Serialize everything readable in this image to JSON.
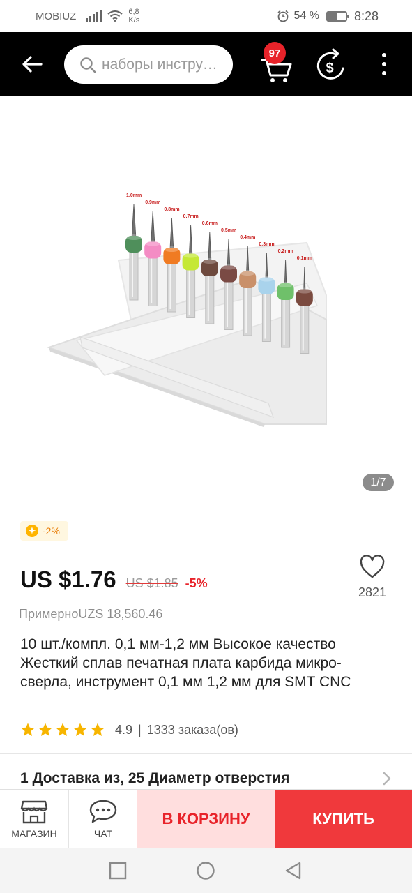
{
  "status_bar": {
    "carrier": "MOBIUZ",
    "speed_value": "6,8",
    "speed_unit": "K/s",
    "battery": "54 %",
    "battery_level": 0.54,
    "time": "8:28"
  },
  "app_bar": {
    "search_placeholder": "наборы инструменты",
    "cart_count": "97",
    "icons": [
      "back-arrow-icon",
      "search-icon",
      "cart-icon",
      "coin-cashback-icon",
      "more-vertical-icon"
    ]
  },
  "gallery": {
    "counter": "1/7",
    "drill_labels": [
      "1.0mm",
      "0.9mm",
      "0.8mm",
      "0.7mm",
      "0.6mm",
      "0.5mm",
      "0.4mm",
      "0.3mm",
      "0.2mm",
      "0.1mm"
    ],
    "ring_colors": [
      "#4f8f5b",
      "#f48cc4",
      "#f07b22",
      "#c5e836",
      "#6e4a3e",
      "#7a4a44",
      "#c9906a",
      "#a9d3ec",
      "#6fc06a",
      "#7a4a3f"
    ]
  },
  "product": {
    "coupon": "-2%",
    "price": "US $1.76",
    "old_price": "US $1.85",
    "discount": "-5%",
    "wishlist_count": "2821",
    "approx_price": "ПримерноUZS 18,560.46",
    "title": "10 шт./компл. 0,1 мм-1,2 мм Высокое качество Жесткий сплав печатная плата карбида микро-сверла, инструмент 0,1 мм 1,2 мм для SMT CNC",
    "rating": "4.9",
    "rating_stars": 5,
    "orders": "1333 заказа(ов)",
    "shipping_text": "1 Доставка из, 25 Диаметр отверстия"
  },
  "bottom_bar": {
    "shop_label": "МАГАЗИН",
    "chat_label": "ЧАТ",
    "add_to_cart_label": "В КОРЗИНУ",
    "buy_label": "КУПИТЬ"
  },
  "colors": {
    "accent_red": "#e8232a",
    "buy_button": "#f0393c",
    "cart_button_bg": "#ffdede",
    "star": "#f7b500",
    "app_bar": "#000000"
  }
}
